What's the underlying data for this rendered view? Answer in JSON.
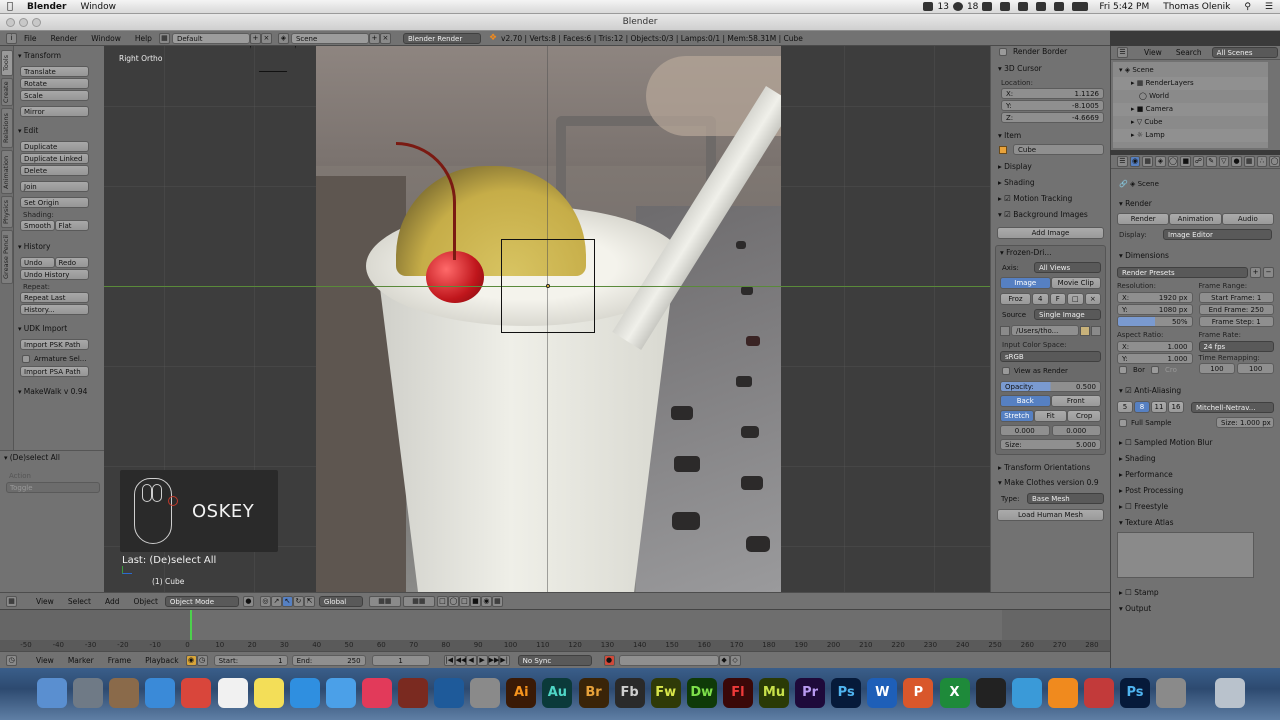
{
  "macbar": {
    "app": "Blender",
    "menus": [
      "Window"
    ],
    "battery": "13",
    "notif": "18",
    "clock": "Fri 5:42 PM",
    "user": "Thomas Olenik"
  },
  "window": {
    "title": "Blender"
  },
  "infobar": {
    "menus": [
      "File",
      "Render",
      "Window",
      "Help"
    ],
    "layout": "Default",
    "scene": "Scene",
    "engine": "Blender Render",
    "stats": "v2.70 | Verts:8 | Faces:6 | Tris:12 | Objects:0/3 | Lamps:0/1 | Mem:58.31M | Cube"
  },
  "tabs": [
    "Tools",
    "Create",
    "Relations",
    "Animation",
    "Physics",
    "Grease Pencil"
  ],
  "shelf": {
    "transform": {
      "title": "Transform",
      "buttons": [
        "Translate",
        "Rotate",
        "Scale",
        "Mirror"
      ]
    },
    "edit": {
      "title": "Edit",
      "buttons": [
        "Duplicate",
        "Duplicate Linked",
        "Delete",
        "Join",
        "Set Origin"
      ],
      "shading_label": "Shading:",
      "smooth": "Smooth",
      "flat": "Flat"
    },
    "history": {
      "title": "History",
      "undo": "Undo",
      "redo": "Redo",
      "undo_history": "Undo History",
      "repeat_label": "Repeat:",
      "repeat_last": "Repeat Last",
      "history_btn": "History..."
    },
    "udk": {
      "title": "UDK Import",
      "import_psk": "Import PSK Path",
      "armature": "Armature Sel...",
      "import_psa": "Import PSA Path"
    },
    "makewalk": {
      "title": "MakeWalk v 0.94"
    }
  },
  "operator": {
    "title": "(De)select All",
    "action_label": "Action",
    "action_value": "Toggle"
  },
  "viewport": {
    "view_label": "Right Ortho",
    "oskey": "OSKEY",
    "last_op": "Last: (De)select All",
    "object_label": "(1) Cube"
  },
  "npanel": {
    "render_border": "Render Border",
    "cursor": {
      "title": "3D Cursor",
      "location": "Location:",
      "x": "1.1126",
      "y": "-8.1005",
      "z": "-4.6669"
    },
    "item": {
      "title": "Item",
      "name": "Cube"
    },
    "display": "Display",
    "shading": "Shading",
    "motion_tracking": "Motion Tracking",
    "background_images": "Background Images",
    "add_image": "Add Image",
    "bg": {
      "name": "Frozen-Dri...",
      "axis_label": "Axis:",
      "axis_value": "All Views",
      "tab_image": "Image",
      "tab_movie": "Movie Clip",
      "img_name": "Froz",
      "img_users": "4",
      "img_fake": "F",
      "source_label": "Source",
      "source_value": "Single Image",
      "path": "/Users/tho...",
      "color_space_label": "Input Color Space:",
      "color_space": "sRGB",
      "view_as_render": "View as Render",
      "opacity_label": "Opacity:",
      "opacity_value": "0.500",
      "back": "Back",
      "front": "Front",
      "stretch": "Stretch",
      "fit": "Fit",
      "crop": "Crop",
      "offset_x": "0.000",
      "offset_y": "0.000",
      "size_label": "Size:",
      "size_value": "5.000"
    },
    "transform_orient": "Transform Orientations",
    "make_clothes": "Make Clothes version 0.9",
    "type_label": "Type:",
    "type_value": "Base Mesh",
    "load_human": "Load Human Mesh"
  },
  "outliner": {
    "view": "View",
    "search": "Search",
    "scope": "All Scenes",
    "items": [
      "Scene",
      "RenderLayers",
      "World",
      "Camera",
      "Cube",
      "Lamp"
    ]
  },
  "props": {
    "context": "Scene",
    "render": {
      "title": "Render",
      "render_btn": "Render",
      "animation_btn": "Animation",
      "audio_btn": "Audio",
      "display_label": "Display:",
      "display_value": "Image Editor"
    },
    "dimensions": {
      "title": "Dimensions",
      "presets": "Render Presets",
      "resolution_label": "Resolution:",
      "res_x": "1920 px",
      "res_y": "1080 px",
      "res_pct": "50%",
      "frame_range_label": "Frame Range:",
      "start": "Start Frame: 1",
      "end": "End Frame: 250",
      "step": "Frame Step: 1",
      "aspect_label": "Aspect Ratio:",
      "asp_x": "1.000",
      "asp_y": "1.000",
      "frame_rate_label": "Frame Rate:",
      "fps": "24 fps",
      "time_remap_label": "Time Remapping:",
      "remap_old": "100",
      "remap_new": "100",
      "bor": "Bor",
      "cro": "Cro"
    },
    "aa": {
      "title": "Anti-Aliasing",
      "samples": [
        "5",
        "8",
        "11",
        "16"
      ],
      "filter": "Mitchell-Netrav...",
      "full_sample": "Full Sample",
      "size": "Size: 1.000 px"
    },
    "closed_panels": [
      "Sampled Motion Blur",
      "Shading",
      "Performance",
      "Post Processing",
      "Freestyle",
      "Texture Atlas"
    ],
    "stamp": "Stamp",
    "output": "Output"
  },
  "vp_header": {
    "view": "View",
    "select": "Select",
    "add": "Add",
    "object": "Object",
    "mode": "Object Mode",
    "orientation": "Global"
  },
  "timeline": {
    "ticks": [
      "-50",
      "-40",
      "-30",
      "-20",
      "-10",
      "0",
      "10",
      "20",
      "30",
      "40",
      "50",
      "60",
      "70",
      "80",
      "90",
      "100",
      "110",
      "120",
      "130",
      "140",
      "150",
      "160",
      "170",
      "180",
      "190",
      "200",
      "210",
      "220",
      "230",
      "240",
      "250",
      "260",
      "270",
      "280"
    ]
  },
  "tl_header": {
    "view": "View",
    "marker": "Marker",
    "frame": "Frame",
    "playback": "Playback",
    "start": "Start:",
    "start_value": "1",
    "end": "End:",
    "end_value": "250",
    "current": "1",
    "sync": "No Sync"
  },
  "dock": [
    {
      "name": "finder-icon",
      "label": "",
      "color": "#5a8fd0"
    },
    {
      "name": "launchpad-icon",
      "label": "",
      "color": "#6f7a86"
    },
    {
      "name": "preview-icon",
      "label": "",
      "color": "#8a6a4a"
    },
    {
      "name": "safari-icon",
      "label": "",
      "color": "#3a8ad8"
    },
    {
      "name": "chrome-icon",
      "label": "",
      "color": "#d9463b"
    },
    {
      "name": "textedit-icon",
      "label": "",
      "color": "#f1f1f1"
    },
    {
      "name": "stickies-icon",
      "label": "",
      "color": "#f3de58"
    },
    {
      "name": "appstore-icon",
      "label": "",
      "color": "#2f8fe0"
    },
    {
      "name": "messages-icon",
      "label": "",
      "color": "#4ba0e8"
    },
    {
      "name": "itunes-icon",
      "label": "",
      "color": "#e23a5a"
    },
    {
      "name": "photobooth-icon",
      "label": "",
      "color": "#7a2a20"
    },
    {
      "name": "quicktime-icon",
      "label": "",
      "color": "#1e5a9a"
    },
    {
      "name": "sysprefs-icon",
      "label": "",
      "color": "#8a8a8a"
    },
    {
      "name": "illustrator-icon",
      "label": "Ai",
      "color": "#3a1a06",
      "fg": "#f7941d"
    },
    {
      "name": "audition-icon",
      "label": "Au",
      "color": "#0b3a3a",
      "fg": "#4fd6c6"
    },
    {
      "name": "bridge-icon",
      "label": "Br",
      "color": "#3a2408",
      "fg": "#e8a23a"
    },
    {
      "name": "flashbuilder-icon",
      "label": "Fb",
      "color": "#2a2a2a",
      "fg": "#cfcfcf"
    },
    {
      "name": "fireworks-icon",
      "label": "Fw",
      "color": "#2f3a08",
      "fg": "#d9e64a"
    },
    {
      "name": "dreamweaver-icon",
      "label": "Dw",
      "color": "#0f3a08",
      "fg": "#7ee04a"
    },
    {
      "name": "flash-icon",
      "label": "Fl",
      "color": "#3a0808",
      "fg": "#ee3a3a"
    },
    {
      "name": "muse-icon",
      "label": "Mu",
      "color": "#2a3a06",
      "fg": "#c8e04a"
    },
    {
      "name": "premiere-icon",
      "label": "Pr",
      "color": "#1e0a3a",
      "fg": "#b89af0"
    },
    {
      "name": "photoshop-icon",
      "label": "Ps",
      "color": "#061a3a",
      "fg": "#4fb4f0"
    },
    {
      "name": "word-icon",
      "label": "W",
      "color": "#1e5fb8",
      "fg": "#ffffff"
    },
    {
      "name": "powerpoint-icon",
      "label": "P",
      "color": "#d9572b",
      "fg": "#ffffff"
    },
    {
      "name": "excel-icon",
      "label": "X",
      "color": "#1e8a3a",
      "fg": "#ffffff"
    },
    {
      "name": "unity-icon",
      "label": "",
      "color": "#222222"
    },
    {
      "name": "makehuman-icon",
      "label": "",
      "color": "#3a9ad8"
    },
    {
      "name": "blender-icon",
      "label": "",
      "color": "#f08a1e"
    },
    {
      "name": "photobooth2-icon",
      "label": "",
      "color": "#c23a3a"
    },
    {
      "name": "photoshop2-icon",
      "label": "Ps",
      "color": "#061a3a",
      "fg": "#4fb4f0"
    },
    {
      "name": "preview2-icon",
      "label": "",
      "color": "#8a8a8a"
    },
    {
      "name": "trash-icon",
      "label": "",
      "color": "#b9c2cc"
    }
  ]
}
